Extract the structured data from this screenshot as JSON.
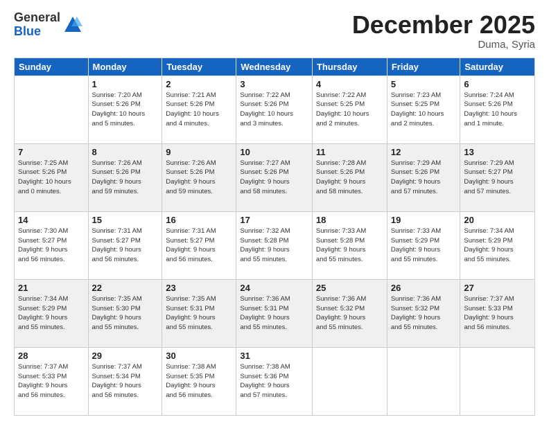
{
  "header": {
    "logo_general": "General",
    "logo_blue": "Blue",
    "month_title": "December 2025",
    "location": "Duma, Syria"
  },
  "weekdays": [
    "Sunday",
    "Monday",
    "Tuesday",
    "Wednesday",
    "Thursday",
    "Friday",
    "Saturday"
  ],
  "weeks": [
    [
      {
        "day": "",
        "detail": ""
      },
      {
        "day": "1",
        "detail": "Sunrise: 7:20 AM\nSunset: 5:26 PM\nDaylight: 10 hours\nand 5 minutes."
      },
      {
        "day": "2",
        "detail": "Sunrise: 7:21 AM\nSunset: 5:26 PM\nDaylight: 10 hours\nand 4 minutes."
      },
      {
        "day": "3",
        "detail": "Sunrise: 7:22 AM\nSunset: 5:26 PM\nDaylight: 10 hours\nand 3 minutes."
      },
      {
        "day": "4",
        "detail": "Sunrise: 7:22 AM\nSunset: 5:25 PM\nDaylight: 10 hours\nand 2 minutes."
      },
      {
        "day": "5",
        "detail": "Sunrise: 7:23 AM\nSunset: 5:25 PM\nDaylight: 10 hours\nand 2 minutes."
      },
      {
        "day": "6",
        "detail": "Sunrise: 7:24 AM\nSunset: 5:26 PM\nDaylight: 10 hours\nand 1 minute."
      }
    ],
    [
      {
        "day": "7",
        "detail": "Sunrise: 7:25 AM\nSunset: 5:26 PM\nDaylight: 10 hours\nand 0 minutes."
      },
      {
        "day": "8",
        "detail": "Sunrise: 7:26 AM\nSunset: 5:26 PM\nDaylight: 9 hours\nand 59 minutes."
      },
      {
        "day": "9",
        "detail": "Sunrise: 7:26 AM\nSunset: 5:26 PM\nDaylight: 9 hours\nand 59 minutes."
      },
      {
        "day": "10",
        "detail": "Sunrise: 7:27 AM\nSunset: 5:26 PM\nDaylight: 9 hours\nand 58 minutes."
      },
      {
        "day": "11",
        "detail": "Sunrise: 7:28 AM\nSunset: 5:26 PM\nDaylight: 9 hours\nand 58 minutes."
      },
      {
        "day": "12",
        "detail": "Sunrise: 7:29 AM\nSunset: 5:26 PM\nDaylight: 9 hours\nand 57 minutes."
      },
      {
        "day": "13",
        "detail": "Sunrise: 7:29 AM\nSunset: 5:27 PM\nDaylight: 9 hours\nand 57 minutes."
      }
    ],
    [
      {
        "day": "14",
        "detail": "Sunrise: 7:30 AM\nSunset: 5:27 PM\nDaylight: 9 hours\nand 56 minutes."
      },
      {
        "day": "15",
        "detail": "Sunrise: 7:31 AM\nSunset: 5:27 PM\nDaylight: 9 hours\nand 56 minutes."
      },
      {
        "day": "16",
        "detail": "Sunrise: 7:31 AM\nSunset: 5:27 PM\nDaylight: 9 hours\nand 56 minutes."
      },
      {
        "day": "17",
        "detail": "Sunrise: 7:32 AM\nSunset: 5:28 PM\nDaylight: 9 hours\nand 55 minutes."
      },
      {
        "day": "18",
        "detail": "Sunrise: 7:33 AM\nSunset: 5:28 PM\nDaylight: 9 hours\nand 55 minutes."
      },
      {
        "day": "19",
        "detail": "Sunrise: 7:33 AM\nSunset: 5:29 PM\nDaylight: 9 hours\nand 55 minutes."
      },
      {
        "day": "20",
        "detail": "Sunrise: 7:34 AM\nSunset: 5:29 PM\nDaylight: 9 hours\nand 55 minutes."
      }
    ],
    [
      {
        "day": "21",
        "detail": "Sunrise: 7:34 AM\nSunset: 5:29 PM\nDaylight: 9 hours\nand 55 minutes."
      },
      {
        "day": "22",
        "detail": "Sunrise: 7:35 AM\nSunset: 5:30 PM\nDaylight: 9 hours\nand 55 minutes."
      },
      {
        "day": "23",
        "detail": "Sunrise: 7:35 AM\nSunset: 5:31 PM\nDaylight: 9 hours\nand 55 minutes."
      },
      {
        "day": "24",
        "detail": "Sunrise: 7:36 AM\nSunset: 5:31 PM\nDaylight: 9 hours\nand 55 minutes."
      },
      {
        "day": "25",
        "detail": "Sunrise: 7:36 AM\nSunset: 5:32 PM\nDaylight: 9 hours\nand 55 minutes."
      },
      {
        "day": "26",
        "detail": "Sunrise: 7:36 AM\nSunset: 5:32 PM\nDaylight: 9 hours\nand 55 minutes."
      },
      {
        "day": "27",
        "detail": "Sunrise: 7:37 AM\nSunset: 5:33 PM\nDaylight: 9 hours\nand 56 minutes."
      }
    ],
    [
      {
        "day": "28",
        "detail": "Sunrise: 7:37 AM\nSunset: 5:33 PM\nDaylight: 9 hours\nand 56 minutes."
      },
      {
        "day": "29",
        "detail": "Sunrise: 7:37 AM\nSunset: 5:34 PM\nDaylight: 9 hours\nand 56 minutes."
      },
      {
        "day": "30",
        "detail": "Sunrise: 7:38 AM\nSunset: 5:35 PM\nDaylight: 9 hours\nand 56 minutes."
      },
      {
        "day": "31",
        "detail": "Sunrise: 7:38 AM\nSunset: 5:36 PM\nDaylight: 9 hours\nand 57 minutes."
      },
      {
        "day": "",
        "detail": ""
      },
      {
        "day": "",
        "detail": ""
      },
      {
        "day": "",
        "detail": ""
      }
    ]
  ]
}
